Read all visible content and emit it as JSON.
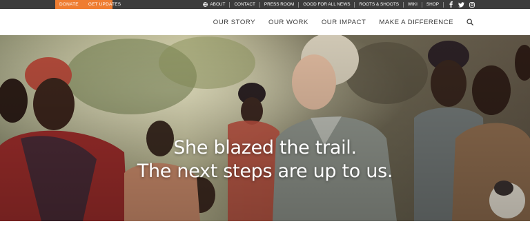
{
  "utility_bar": {
    "donate": "DONATE",
    "get_updates": "GET UPDATES",
    "links": [
      {
        "name": "util-link-about",
        "label": "ABOUT",
        "icon": "globe-icon"
      },
      {
        "name": "util-link-contact",
        "label": "CONTACT"
      },
      {
        "name": "util-link-press-room",
        "label": "PRESS ROOM"
      },
      {
        "name": "util-link-good-for-all-news",
        "label": "GOOD FOR ALL NEWS"
      },
      {
        "name": "util-link-roots-shoots",
        "label": "ROOTS & SHOOTS"
      },
      {
        "name": "util-link-wiki",
        "label": "WIKI"
      },
      {
        "name": "util-link-shop",
        "label": "SHOP"
      }
    ],
    "social_icons": [
      "facebook-icon",
      "twitter-icon",
      "instagram-icon"
    ]
  },
  "main_nav": {
    "items": [
      {
        "name": "nav-our-story",
        "label": "OUR STORY"
      },
      {
        "name": "nav-our-work",
        "label": "OUR WORK"
      },
      {
        "name": "nav-our-impact",
        "label": "OUR IMPACT"
      },
      {
        "name": "nav-make-a-difference",
        "label": "MAKE A DIFFERENCE"
      }
    ],
    "search_icon": "search-icon"
  },
  "hero": {
    "headline_line1": "She blazed the trail.",
    "headline_line2": "The next steps are up to us."
  },
  "colors": {
    "utility_bar_bg": "#3c3c3c",
    "accent_orange": "#ef7d31",
    "nav_text": "#3a3a3a"
  }
}
